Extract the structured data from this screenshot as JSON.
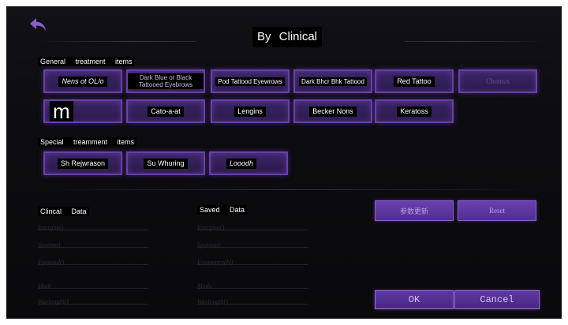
{
  "header": {
    "title": "By Clinical",
    "back_icon": "back-arrow-icon",
    "accent_color": "#8a5ed0"
  },
  "general": {
    "label": "General treatment items",
    "buttons": [
      "Nens ot OL/o",
      "Dark Blue or Black Tattooed Eyebrows",
      "Pod Tattood Eyewrows",
      "Dark Bhcr Bhk Tattood",
      "Red Tattoo",
      "Cbomus",
      "m",
      "Cato-a-at",
      "Lengins",
      "Becker Nons",
      "Keratoss"
    ]
  },
  "special": {
    "label": "Special treamment items",
    "buttons": [
      "Sh Rejwrason",
      "Su Whuring",
      "Looodh"
    ]
  },
  "clinical_data": {
    "header": "Clincal Data",
    "rows": [
      "Energim()",
      "Spotmm)",
      "Fpunosd()",
      "Modt",
      "Wavlength()"
    ]
  },
  "saved_data": {
    "header": "Saved Data",
    "rows": [
      "Energmn()",
      "Spotsize)",
      "Frequency(H)",
      "Modo",
      "Wavlength()"
    ]
  },
  "actions": {
    "update_label": "参数更新",
    "reset_label": "Reset",
    "ok_label": "OK",
    "cancel_label": "Cancel"
  }
}
